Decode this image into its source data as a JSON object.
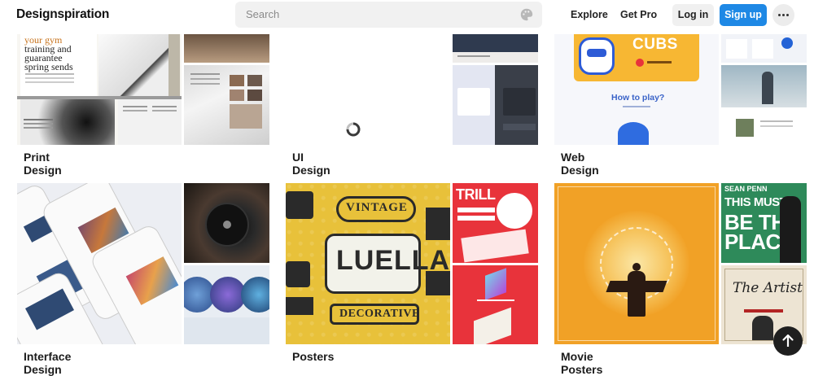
{
  "header": {
    "logo": "Designspiration",
    "search_placeholder": "Search",
    "nav_explore": "Explore",
    "nav_get_pro": "Get Pro",
    "login": "Log in",
    "signup": "Sign up"
  },
  "collections": [
    {
      "title": "Print Design"
    },
    {
      "title": "UI Design"
    },
    {
      "title": "Web Design"
    },
    {
      "title": "Interface Design"
    },
    {
      "title": "Posters"
    },
    {
      "title": "Movie Posters"
    }
  ],
  "thumbs": {
    "print_headline": [
      "your gym",
      "training and",
      "guarantee",
      "spring sends"
    ],
    "web_brand": "CUBS",
    "web_question": "How to play?",
    "poster_words": [
      "VINTAGE",
      "LUELLA",
      "DECORATIVE"
    ],
    "poster_trill": "TRILL",
    "movie_actor": "SEAN PENN",
    "movie_title": [
      "THIS MUST",
      "BE THE",
      "PLACE"
    ],
    "movie_artist": "The Artist"
  },
  "colors": {
    "accent": "#1e88e5",
    "poster_yellow": "#e8c13a",
    "poster_red": "#e8333b",
    "movie_orange": "#f1a126",
    "movie_green": "#2e8a5a"
  }
}
